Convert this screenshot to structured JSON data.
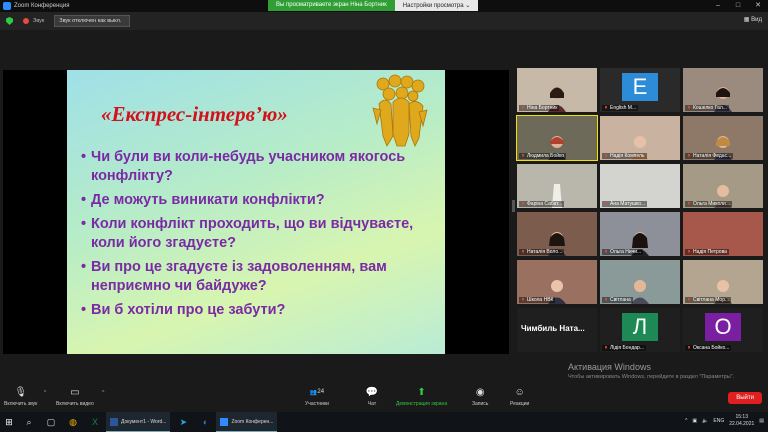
{
  "window": {
    "title": "Zoom Конференция",
    "minimize": "–",
    "maximize": "□",
    "close": "✕"
  },
  "share_banner": {
    "viewing": "Вы просматриваете экран Ніна Бортник",
    "view_options": "Настройки просмотра ⌄"
  },
  "topbar": {
    "talking_label": "Звук",
    "speaker_select": "Звук отключен как выкл.",
    "view_button": "▦ Вид"
  },
  "slide": {
    "title": "«Експрес-інтерв’ю»",
    "bullets": [
      "Чи були ви коли-небудь учасником якогось конфлікту?",
      "Де можуть виникати конфлікти?",
      "Коли конфлікт проходить, що ви відчуваєте, коли його згадуєте?",
      "Ви про це згадуєте із задоволенням, вам неприємно чи байдуже?",
      "Ви б хотіли про це забути?"
    ]
  },
  "gallery": {
    "tiles": [
      {
        "name": "Ніна Бортник",
        "letter": "",
        "bg": "#8a6a55"
      },
      {
        "name": "English M...",
        "letter": "E",
        "bg": "#2d8cd8"
      },
      {
        "name": "Кошелко Гал...",
        "letter": "",
        "bg": "#7a6b60"
      },
      {
        "name": "Людмила Бойко",
        "letter": "",
        "bg": "#6e6a5a"
      },
      {
        "name": "Надія Компель",
        "letter": "",
        "bg": "#c9b2a0"
      },
      {
        "name": "Наталія Федас...",
        "letter": "",
        "bg": "#8e7868"
      },
      {
        "name": "Фаріна Сабат...",
        "letter": "",
        "bg": "#b9b6ac"
      },
      {
        "name": "Ана Матушко...",
        "letter": "",
        "bg": "#d3d3cf"
      },
      {
        "name": "Ольга Миколи...",
        "letter": "",
        "bg": "#a59a85"
      },
      {
        "name": "Наталія Воло...",
        "letter": "",
        "bg": "#7c5c4c"
      },
      {
        "name": "Ольга Ничи...",
        "letter": "",
        "bg": "#8d9098"
      },
      {
        "name": "Надія Петрова",
        "letter": "",
        "bg": "#a8584a"
      },
      {
        "name": "Школа НВК",
        "letter": "",
        "bg": "#9a7060"
      },
      {
        "name": "Світлана",
        "letter": "",
        "bg": "#8a9a98"
      },
      {
        "name": "Світлана Мор...",
        "letter": "",
        "bg": "#b3a58f"
      },
      {
        "name": "Чимбиль Ната...",
        "letter": "",
        "bg": "#1f1f1f"
      },
      {
        "name": "Лідія Бондар...",
        "letter": "Л",
        "bg": "#1d8a55"
      },
      {
        "name": "Оксана Бойко...",
        "letter": "О",
        "bg": "#7b1fa2"
      }
    ]
  },
  "watermark": {
    "title": "Активация Windows",
    "subtitle": "Чтобы активировать Windows, перейдите в раздел \"Параметры\"."
  },
  "toolbar": {
    "unmute": "Включить звук",
    "start_video": "Включить видео",
    "participants": "Участники",
    "participants_count": "24",
    "chat": "Чат",
    "share": "Демонстрация экрана",
    "record": "Запись",
    "reactions": "Реакции",
    "end": "Выйти"
  },
  "taskbar": {
    "word_app": "Документ1 - Word...",
    "zoom_app": "Zoom Конферен...",
    "lang": "ENG",
    "time": "15:13",
    "date": "22.04.2021"
  },
  "colors": {
    "slide_title": "#d6101a",
    "slide_text": "#7b2aa6",
    "share_green": "#2e9e35",
    "end_red": "#e02020",
    "active_speaker": "#f5e000"
  }
}
